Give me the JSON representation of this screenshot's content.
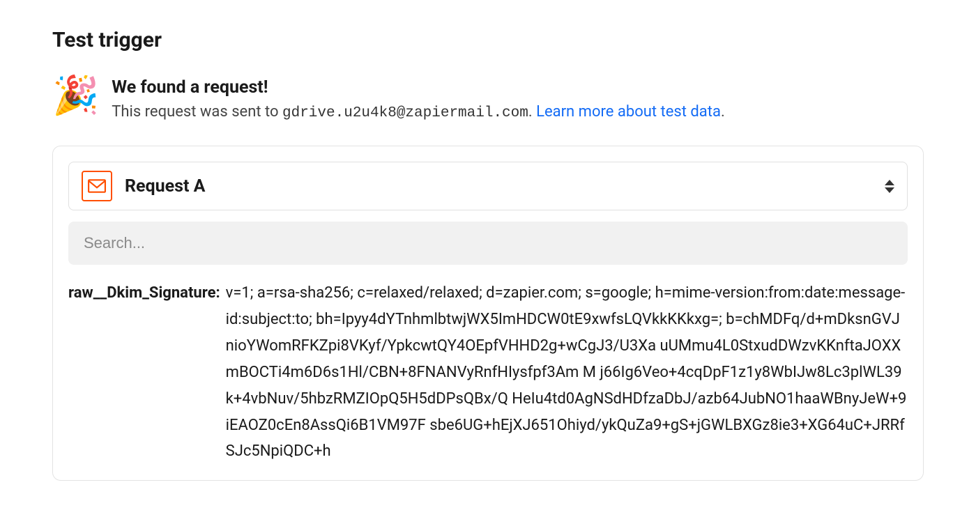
{
  "header": {
    "title": "Test trigger"
  },
  "found": {
    "icon": "🎉",
    "title": "We found a request!",
    "subtitle_prefix": "This request was sent to ",
    "email": "gdrive.u2u4k8@zapiermail.com",
    "subtitle_suffix": ". ",
    "learn_link_text": "Learn more about test data",
    "trailing_period": "."
  },
  "card": {
    "dropdown": {
      "icon_name": "mail-icon",
      "label": "Request A"
    },
    "search": {
      "placeholder": "Search..."
    },
    "fields": [
      {
        "key": "raw__Dkim_Signature:",
        "value": "v=1; a=rsa-sha256; c=relaxed/relaxed; d=zapier.com; s=google; h=mime-version:from:date:message-id:subject:to; bh=Ipyy4dYTnhmlbtwjWX5ImHDCW0tE9xwfsLQVkkKKkxg=; b=chMDFq/d+mDksnGVJnioYWomRFKZpi8VKyf/YpkcwtQY4OEpfVHHD2g+wCgJ3/U3Xa uUMmu4L0StxudDWzvKKnftaJOXXmBOCTi4m6D6s1Hl/CBN+8FNANVyRnfHIysfpf3Am M j66Ig6Veo+4cqDpF1z1y8WbIJw8Lc3plWL39k+4vbNuv/5hbzRMZIOpQ5H5dDPsQBx/Q HeIu4td0AgNSdHDfzaDbJ/azb64JubNO1haaWBnyJeW+9iEAOZ0cEn8AssQi6B1VM97F sbe6UG+hEjXJ651Ohiyd/ykQuZa9+gS+jGWLBXGz8ie3+XG64uC+JRRfSJc5NpiQDC+h"
      }
    ]
  }
}
